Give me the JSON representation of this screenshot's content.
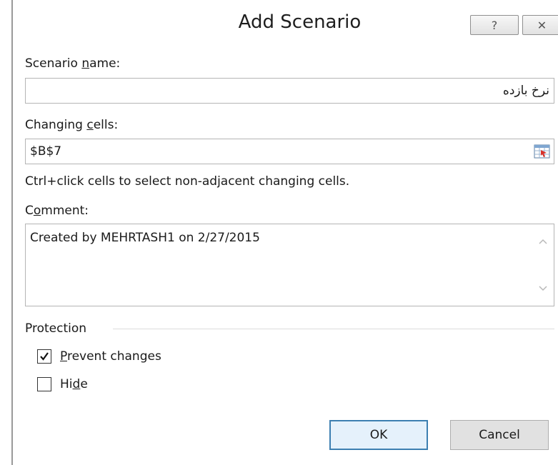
{
  "dialog": {
    "title": "Add Scenario",
    "help_label": "?",
    "close_label": "✕"
  },
  "scenario_name": {
    "label_before": "Scenario ",
    "label_underlined": "n",
    "label_after": "ame:",
    "value": "نرخ بازده"
  },
  "changing_cells": {
    "label_before": "Changing ",
    "label_underlined": "c",
    "label_after": "ells:",
    "value": "$B$7",
    "hint": "Ctrl+click cells to select non-adjacent changing cells."
  },
  "comment": {
    "label_before": "C",
    "label_underlined": "o",
    "label_after": "mment:",
    "value": "Created by MEHRTASH1 on 2/27/2015"
  },
  "protection": {
    "label": "Protection",
    "prevent_changes": {
      "label_underlined": "P",
      "label_after": "revent changes",
      "checked": true
    },
    "hide": {
      "label_before": "Hi",
      "label_underlined": "d",
      "label_after": "e",
      "checked": false
    }
  },
  "buttons": {
    "ok": "OK",
    "cancel": "Cancel"
  },
  "icons": {
    "help": "help-icon",
    "close": "close-icon",
    "range_select": "range-selector-icon",
    "scroll_up": "chevron-up-icon",
    "scroll_down": "chevron-down-icon",
    "check": "checkmark-icon"
  }
}
